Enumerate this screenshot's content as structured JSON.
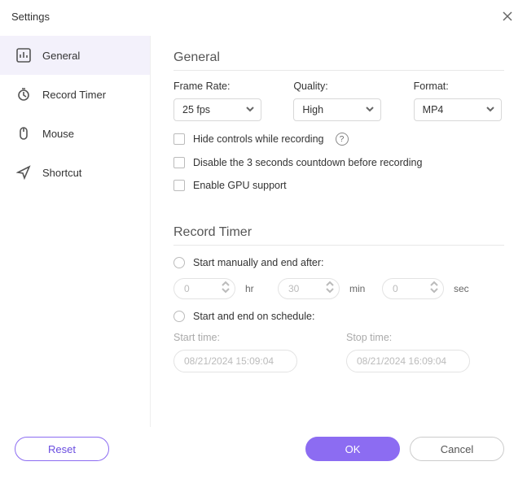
{
  "window": {
    "title": "Settings"
  },
  "sidebar": {
    "items": [
      {
        "label": "General"
      },
      {
        "label": "Record Timer"
      },
      {
        "label": "Mouse"
      },
      {
        "label": "Shortcut"
      }
    ],
    "selected_index": 0
  },
  "general": {
    "heading": "General",
    "frame_rate_label": "Frame Rate:",
    "frame_rate_value": "25 fps",
    "quality_label": "Quality:",
    "quality_value": "High",
    "format_label": "Format:",
    "format_value": "MP4",
    "hide_controls_label": "Hide controls while recording",
    "hide_controls_checked": false,
    "disable_countdown_label": "Disable the 3 seconds countdown before recording",
    "disable_countdown_checked": false,
    "gpu_label": "Enable GPU support",
    "gpu_checked": false,
    "help_glyph": "?"
  },
  "record_timer": {
    "heading": "Record Timer",
    "option_manual_label": "Start manually and end after:",
    "option_manual_selected": false,
    "hr_value": "0",
    "hr_unit": "hr",
    "min_value": "30",
    "min_unit": "min",
    "sec_value": "0",
    "sec_unit": "sec",
    "option_schedule_label": "Start and end on schedule:",
    "option_schedule_selected": false,
    "start_label": "Start time:",
    "start_value": "08/21/2024 15:09:04",
    "stop_label": "Stop time:",
    "stop_value": "08/21/2024 16:09:04"
  },
  "footer": {
    "reset_label": "Reset",
    "ok_label": "OK",
    "cancel_label": "Cancel"
  },
  "colors": {
    "accent": "#8c6cf2"
  }
}
